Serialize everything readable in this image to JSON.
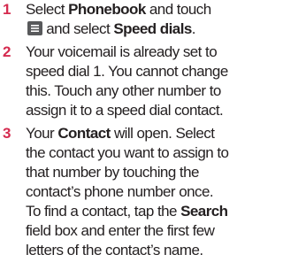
{
  "steps": [
    {
      "number": "1",
      "t1": "Select ",
      "b1": "Phonebook",
      "t2": " and touch ",
      "t3": " and select ",
      "b2": "Speed dials",
      "t4": "."
    },
    {
      "number": "2",
      "t1": "Your voicemail is already set to speed dial 1. You cannot change this. Touch any other number to assign it to a speed dial contact."
    },
    {
      "number": "3",
      "t1": "Your ",
      "b1": "Contact",
      "t2": " will open. Select the contact you want to assign to that number by touching the contact’s phone number once. To find a contact, tap the ",
      "b2": "Search",
      "t3": " field box and enter the first few letters of the contact’s name."
    }
  ],
  "icons": {
    "menu_key": "menu-key-icon"
  },
  "colors": {
    "step_number": "#d52b4f",
    "text": "#231f20",
    "icon": "#58595b"
  }
}
